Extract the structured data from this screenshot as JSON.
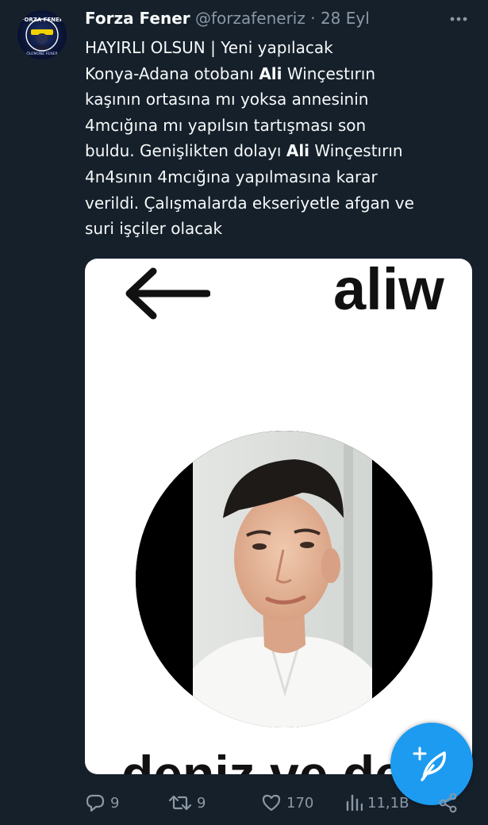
{
  "tweet": {
    "author_name": "Forza Fener",
    "handle": "@forzafeneriz",
    "separator": " · ",
    "date": "28 Eyl",
    "more_icon": "more-dots-icon",
    "lines": [
      "HAYIRLI OLSUN | Yeni yapılacak",
      "Konya-Adana otobanı ",
      "Ali",
      " Winçestırın",
      "kaşının ortasına mı yoksa annesinin",
      "4mcığına mı yapılsın tartışması son",
      "buldu. Genişlikten dolayı ",
      "Ali",
      " Winçestırın",
      "4n4sının 4mcığına yapılmasına karar",
      "verildi. Çalışmalarda ekseriyetle afgan ve",
      "suri işçiler olacak"
    ]
  },
  "media": {
    "top_text": "aliw",
    "bottom_text": "deniz ve de",
    "back_icon": "back-arrow-icon"
  },
  "actions": {
    "replies": "9",
    "retweets": "9",
    "likes": "170",
    "views": "11,1B"
  },
  "avatar": {
    "ring_text_top": "FORZA FENER",
    "ring_text_bottom": "ÖLÜMÜNE FENER"
  },
  "colors": {
    "background": "#15202b",
    "text": "#f7f9f9",
    "secondary": "#8b98a5",
    "accent": "#1d9bf0"
  }
}
